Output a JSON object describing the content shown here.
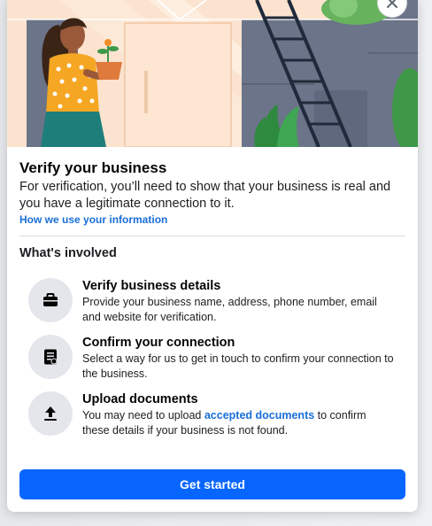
{
  "colors": {
    "accent": "#0866ff",
    "link": "#1a6ed8",
    "hero_bg": "#fbe3cf",
    "icon_circle": "#e4e6eb"
  },
  "modal": {
    "close_icon": "close-icon",
    "title": "Verify your business",
    "description": "For verification, you’ll need to show that your business is real and you have a legitimate connection to it.",
    "info_link": "How we use your information",
    "section_title": "What's involved",
    "steps": [
      {
        "icon": "briefcase-icon",
        "title": "Verify business details",
        "body": "Provide your business name, address, phone number, email and website for verification."
      },
      {
        "icon": "document-icon",
        "title": "Confirm your connection",
        "body": "Select a way for us to get in touch to confirm your connection to the business."
      },
      {
        "icon": "upload-icon",
        "title": "Upload documents",
        "body_before": "You may need to upload ",
        "body_link": "accepted documents",
        "body_after": " to confirm these details if your business is not found."
      }
    ],
    "cta_label": "Get started"
  }
}
